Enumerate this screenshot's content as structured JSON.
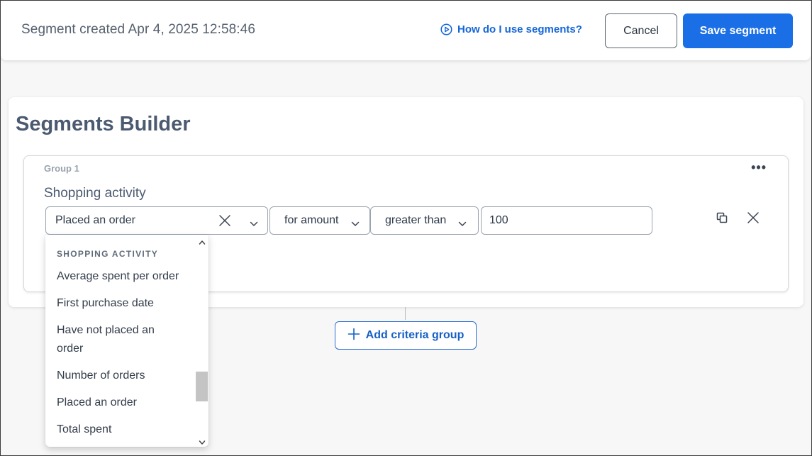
{
  "header": {
    "title": "Segment created Apr 4, 2025 12:58:46",
    "help_link": "How do I use segments?",
    "cancel_label": "Cancel",
    "save_label": "Save segment"
  },
  "builder": {
    "title": "Segments Builder",
    "group": {
      "label": "Group 1",
      "menu": "•••",
      "heading": "Shopping activity",
      "criteria": {
        "activity": "Placed an order",
        "qualifier": "for amount",
        "comparison": "greater than",
        "value": "100"
      }
    },
    "add_group_label": "Add criteria group"
  },
  "dropdown": {
    "category": "SHOPPING ACTIVITY",
    "items": [
      "Average spent per order",
      "First purchase date",
      "Have not placed an order",
      "Number of orders",
      "Placed an order",
      "Total spent"
    ]
  },
  "colors": {
    "accent": "#1b6fe6",
    "link": "#1466d8",
    "text": "#4b5a70"
  }
}
